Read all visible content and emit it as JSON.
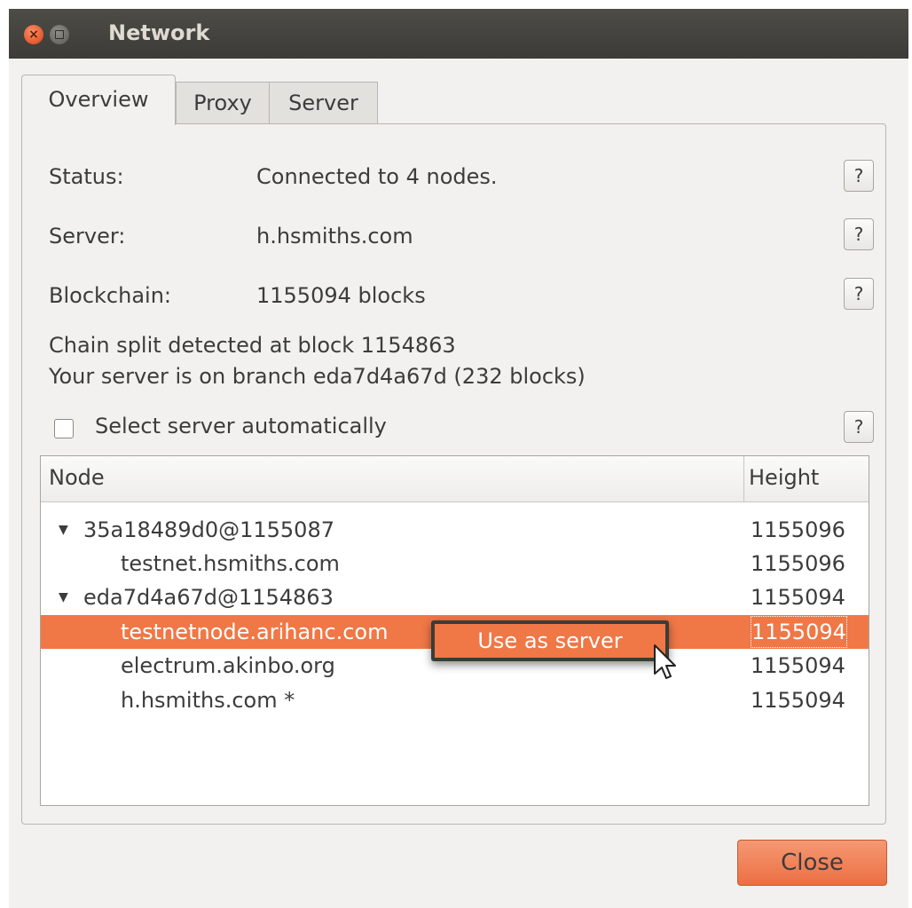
{
  "window": {
    "title": "Network"
  },
  "tabs": [
    {
      "label": "Overview",
      "active": true
    },
    {
      "label": "Proxy",
      "active": false
    },
    {
      "label": "Server",
      "active": false
    }
  ],
  "overview": {
    "status_label": "Status:",
    "status_value": "Connected to 4 nodes.",
    "server_label": "Server:",
    "server_value": "h.hsmiths.com",
    "blockchain_label": "Blockchain:",
    "blockchain_value": "1155094 blocks",
    "split_line1": "Chain split detected at block 1154863",
    "split_line2": "Your server is on branch eda7d4a67d (232 blocks)",
    "auto_select_label": "Select server automatically",
    "auto_select_checked": false,
    "help_label": "?"
  },
  "node_tree": {
    "columns": [
      "Node",
      "Height"
    ],
    "rows": [
      {
        "name": "35a18489d0@1155087",
        "height": "1155096",
        "branch": true,
        "expanded": true
      },
      {
        "name": "testnet.hsmiths.com",
        "height": "1155096",
        "branch": false
      },
      {
        "name": "eda7d4a67d@1154863",
        "height": "1155094",
        "branch": true,
        "expanded": true
      },
      {
        "name": "testnetnode.arihanc.com",
        "height": "1155094",
        "branch": false,
        "selected": true
      },
      {
        "name": "electrum.akinbo.org",
        "height": "1155094",
        "branch": false
      },
      {
        "name": "h.hsmiths.com *",
        "height": "1155094",
        "branch": false
      }
    ]
  },
  "context_menu": {
    "items": [
      "Use as server"
    ]
  },
  "footer": {
    "close_label": "Close"
  },
  "colors": {
    "accent": "#f07746",
    "titlebar": "#3c3b37",
    "background": "#f2f1f0"
  }
}
